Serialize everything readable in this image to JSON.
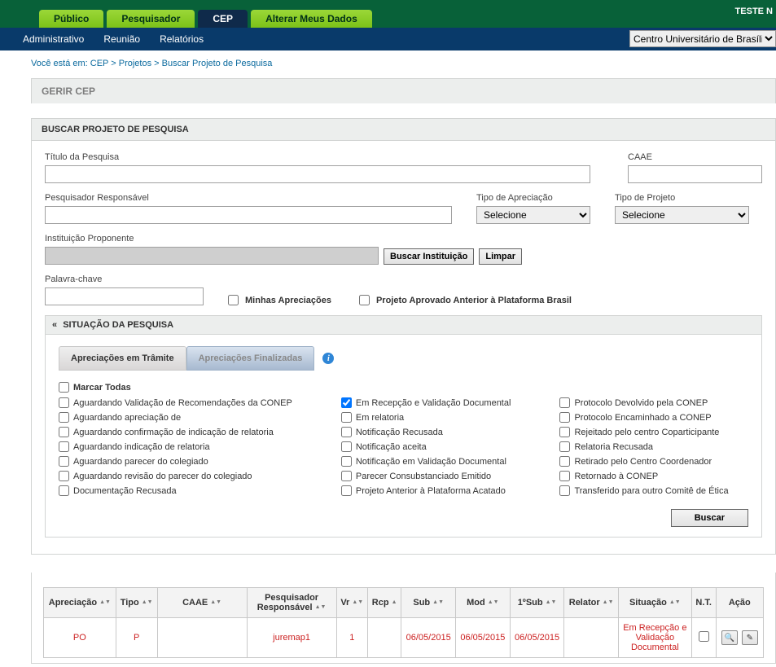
{
  "header": {
    "tabs": [
      "Público",
      "Pesquisador",
      "CEP",
      "Alterar Meus Dados"
    ],
    "user_label": "TESTE N",
    "menu": [
      "Administrativo",
      "Reunião",
      "Relatórios"
    ],
    "institution_select": "Centro Universitário de Brasília"
  },
  "breadcrumb": {
    "prefix": "Você está em:",
    "parts": [
      "CEP",
      "Projetos",
      "Buscar Projeto de Pesquisa"
    ]
  },
  "panels": {
    "main_title": "GERIR CEP",
    "search_title": "BUSCAR PROJETO DE PESQUISA",
    "situacao_title": "SITUAÇÃO DA PESQUISA"
  },
  "form": {
    "titulo_label": "Título da Pesquisa",
    "caae_label": "CAAE",
    "pesq_resp_label": "Pesquisador Responsável",
    "tipo_apreciacao_label": "Tipo de Apreciação",
    "tipo_projeto_label": "Tipo de Projeto",
    "selecione": "Selecione",
    "instituicao_label": "Instituição Proponente",
    "buscar_inst_btn": "Buscar Instituição",
    "limpar_btn": "Limpar",
    "palavra_label": "Palavra-chave",
    "minhas_apreciacoes": "Minhas Apreciações",
    "projeto_anterior": "Projeto Aprovado Anterior à Plataforma Brasil",
    "buscar_btn": "Buscar"
  },
  "subtabs": {
    "tramite": "Apreciações em Trâmite",
    "finalizadas": "Apreciações Finalizadas"
  },
  "checkboxes": {
    "marcar_todas": "Marcar Todas",
    "col1": [
      "Aguardando Validação de Recomendações da CONEP",
      "Aguardando apreciação de",
      "Aguardando confirmação de indicação de relatoria",
      "Aguardando indicação de relatoria",
      "Aguardando parecer do colegiado",
      "Aguardando revisão do parecer do colegiado",
      "Documentação Recusada"
    ],
    "col2": [
      "Em Recepção e Validação Documental",
      "Em relatoria",
      "Notificação Recusada",
      "Notificação aceita",
      "Notificação em Validação Documental",
      "Parecer Consubstanciado Emitido",
      "Projeto Anterior à Plataforma Acatado"
    ],
    "col3": [
      "Protocolo Devolvido pela CONEP",
      "Protocolo Encaminhado a CONEP",
      "Rejeitado pelo centro Coparticipante",
      "Relatoria Recusada",
      "Retirado pelo Centro Coordenador",
      "Retornado à CONEP",
      "Transferido para outro Comitê de Ética"
    ]
  },
  "table": {
    "headers": {
      "apreciacao": "Apreciação",
      "tipo": "Tipo",
      "caae": "CAAE",
      "pesq": "Pesquisador Responsável",
      "vr": "Vr",
      "rcp": "Rcp",
      "sub": "Sub",
      "mod": "Mod",
      "sub1": "1ºSub",
      "relator": "Relator",
      "situacao": "Situação",
      "nt": "N.T.",
      "acao": "Ação"
    },
    "row": {
      "apreciacao": "PO",
      "tipo": "P",
      "caae": "",
      "pesq": "juremap1",
      "vr": "1",
      "rcp": "",
      "sub": "06/05/2015",
      "mod": "06/05/2015",
      "sub1": "06/05/2015",
      "relator": "",
      "situacao": "Em Recepção e Validação Documental"
    }
  }
}
